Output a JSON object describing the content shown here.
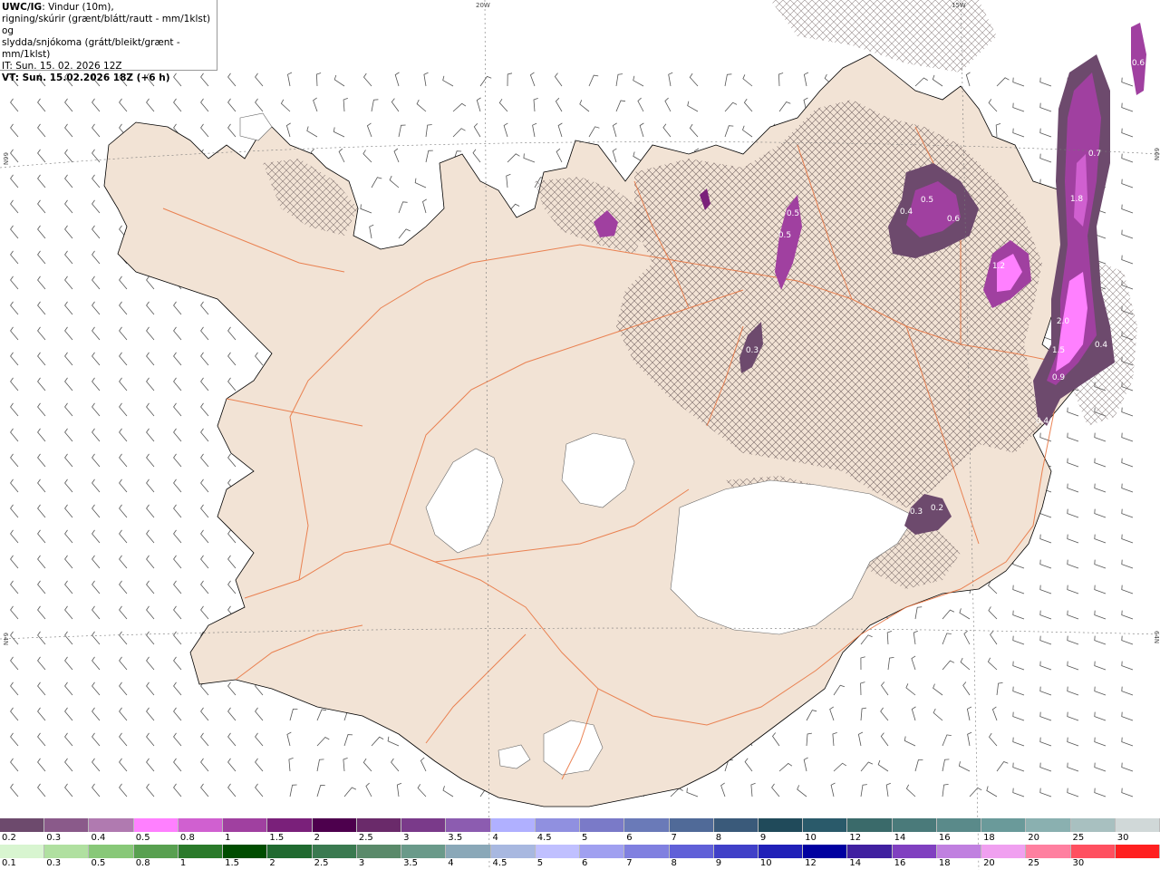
{
  "title": {
    "product": "UWC/IG",
    "line1_rest": ": Vindur (10m),",
    "line2": "rigning/skúrir (grænt/blátt/rautt - mm/1klst) og",
    "line3": "slydda/snjókoma (grátt/bleikt/grænt - mm/1klst)",
    "issue_time": "IT: Sun. 15. 02. 2026 12Z",
    "valid_time": "VT: Sun. 15.02.2026 18Z (+6 h)"
  },
  "grid_labels": {
    "lon_20w": "20W",
    "lon_15w": "15W",
    "lat_66n_left": "66N",
    "lat_66n_right": "66N",
    "lat_64n_left": "64N",
    "lat_64n_right": "64N"
  },
  "precip_labels": [
    {
      "value": "0.4",
      "region": "east"
    },
    {
      "value": "0.7",
      "region": "east"
    },
    {
      "value": "1.8",
      "region": "east"
    },
    {
      "value": "2.0",
      "region": "east"
    },
    {
      "value": "1.5",
      "region": "east"
    },
    {
      "value": "0.9",
      "region": "east"
    },
    {
      "value": "0.4",
      "region": "east"
    },
    {
      "value": "0.4",
      "region": "north"
    },
    {
      "value": "0.5",
      "region": "north"
    },
    {
      "value": "0.6",
      "region": "north"
    },
    {
      "value": "1.2",
      "region": "east"
    },
    {
      "value": "0.5",
      "region": "north"
    },
    {
      "value": "0.5",
      "region": "north"
    },
    {
      "value": "0.3",
      "region": "north"
    },
    {
      "value": "0.3",
      "region": "southeast"
    },
    {
      "value": "0.2",
      "region": "southeast"
    },
    {
      "value": "0.6",
      "region": "far-east"
    }
  ],
  "legend_top": {
    "colors": [
      "#6d4a6d",
      "#8a5a8a",
      "#b07ab0",
      "#ff80ff",
      "#d060d0",
      "#a040a0",
      "#7a207a",
      "#4d004d",
      "#6a2a6a",
      "#7a3a8a",
      "#8c5cb0",
      "#b0b0ff",
      "#9090e0",
      "#7a7ac8",
      "#6a7ab8",
      "#506a98",
      "#3a5a7a",
      "#204a5a",
      "#2a5a6a",
      "#3a6a6a",
      "#4a7a7a",
      "#5a8a8a",
      "#6a9a9a",
      "#8ab0b0",
      "#a8c0c0",
      "#d0d8d8"
    ],
    "labels": [
      "0.2",
      "0.3",
      "0.4",
      "0.5",
      "0.8",
      "1",
      "1.5",
      "2",
      "2.5",
      "3",
      "3.5",
      "4",
      "4.5",
      "5",
      "6",
      "7",
      "8",
      "9",
      "10",
      "12",
      "14",
      "16",
      "18",
      "20",
      "25",
      "30"
    ]
  },
  "legend_bottom": {
    "colors": [
      "#d8f5d0",
      "#b0e0a0",
      "#88c878",
      "#58a050",
      "#2a7a2a",
      "#004d00",
      "#206a30",
      "#3a7a50",
      "#5a8a6a",
      "#6a9a8a",
      "#8aa8b8",
      "#a8b8e0",
      "#c0c0ff",
      "#a0a0f0",
      "#8080e0",
      "#6060d8",
      "#4040c8",
      "#2020b8",
      "#0000a0",
      "#4020a0",
      "#8040c0",
      "#c080e0",
      "#f0a0f0",
      "#ff80a0",
      "#ff5060",
      "#ff2020"
    ],
    "labels": [
      "0.1",
      "0.3",
      "0.5",
      "0.8",
      "1",
      "1.5",
      "2",
      "2.5",
      "3",
      "3.5",
      "4",
      "4.5",
      "5",
      "6",
      "7",
      "8",
      "9",
      "10",
      "12",
      "14",
      "16",
      "18",
      "20",
      "25",
      "30"
    ]
  }
}
